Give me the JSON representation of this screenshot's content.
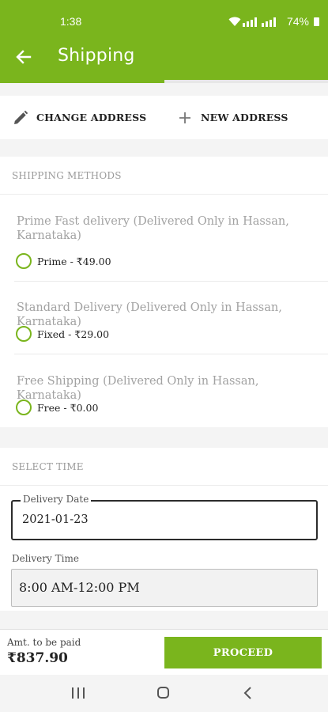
{
  "status_bar": {
    "time": "1:38",
    "battery": "74%"
  },
  "app_bar": {
    "title": "Shipping",
    "progress": 0.5
  },
  "address_actions": {
    "change_label": "CHANGE ADDRESS",
    "new_label": "NEW ADDRESS"
  },
  "shipping_methods": {
    "heading": "SHIPPING METHODS",
    "items": [
      {
        "title": "Prime Fast delivery (Delivered Only in Hassan, Karnataka)",
        "option": "Prime - ₹49.00"
      },
      {
        "title": "Standard Delivery (Delivered Only in Hassan, Karnataka)",
        "option": "Fixed - ₹29.00"
      },
      {
        "title": "Free Shipping (Delivered Only in Hassan, Karnataka)",
        "option": "Free - ₹0.00"
      }
    ]
  },
  "select_time": {
    "heading": "SELECT TIME",
    "date_label": "Delivery Date",
    "date_value": "2021-01-23",
    "time_label": "Delivery Time",
    "time_value": "8:00 AM-12:00 PM"
  },
  "checkout": {
    "amount_label": "Amt. to be paid",
    "amount_value": "₹837.90",
    "proceed_label": "PROCEED"
  },
  "colors": {
    "accent": "#7ab51d",
    "background": "#f4f4f4"
  },
  "icons": [
    "wifi-icon",
    "signal-icon",
    "battery-icon",
    "back-arrow-icon",
    "pencil-icon",
    "plus-icon",
    "radio-unchecked-icon",
    "nav-recents-icon",
    "nav-home-icon",
    "nav-back-icon"
  ]
}
